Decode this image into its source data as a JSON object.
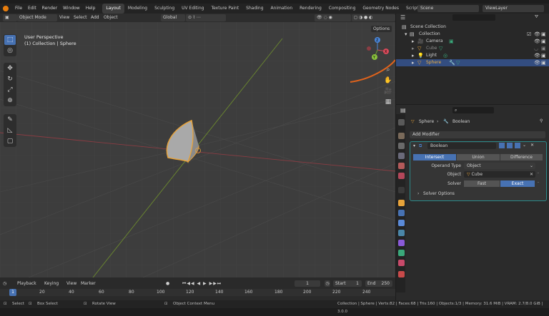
{
  "app": {
    "menus": [
      "File",
      "Edit",
      "Render",
      "Window",
      "Help"
    ],
    "workspaces": [
      "Layout",
      "Modeling",
      "Sculpting",
      "UV Editing",
      "Texture Paint",
      "Shading",
      "Animation",
      "Rendering",
      "Compositing",
      "Geometry Nodes",
      "Scripting"
    ],
    "active_workspace": "Layout",
    "scene": "Scene",
    "view_layer": "ViewLayer"
  },
  "viewport": {
    "mode": "Object Mode",
    "menu": [
      "View",
      "Select",
      "Add",
      "Object"
    ],
    "orientation": "Global",
    "perspective": "User Perspective",
    "context": "(1) Collection | Sphere",
    "options": "Options",
    "gizmo": {
      "x": "X",
      "y": "Y",
      "z": "Z"
    }
  },
  "outliner": {
    "root": "Scene Collection",
    "collection": "Collection",
    "items": [
      {
        "label": "Camera"
      },
      {
        "label": "Cube"
      },
      {
        "label": "Light"
      },
      {
        "label": "Sphere"
      }
    ]
  },
  "properties": {
    "breadcrumb_object": "Sphere",
    "breadcrumb_modifier": "Boolean",
    "add_modifier": "Add Modifier",
    "modifier_name": "Boolean",
    "operations": [
      "Intersect",
      "Union",
      "Difference"
    ],
    "active_operation": "Intersect",
    "operand_type_label": "Operand Type",
    "operand_type": "Object",
    "object_label": "Object",
    "object": "Cube",
    "solver_label": "Solver",
    "solver_options": [
      "Fast",
      "Exact"
    ],
    "active_solver": "Exact",
    "solver_options_panel": "Solver Options"
  },
  "timeline": {
    "menus": [
      "Playback",
      "Keying",
      "View",
      "Marker"
    ],
    "current_frame": "1",
    "start_label": "Start",
    "start": "1",
    "end_label": "End",
    "end": "250",
    "ticks": [
      "1",
      "20",
      "40",
      "60",
      "80",
      "100",
      "120",
      "140",
      "160",
      "180",
      "200",
      "220",
      "240"
    ]
  },
  "status": {
    "select": "Select",
    "box_select": "Box Select",
    "rotate_view": "Rotate View",
    "context_menu": "Object Context Menu",
    "stats": "Collection | Sphere | Verts:82 | Faces:68 | Tris:160 | Objects:1/3 | Memory: 31.6 MiB | VRAM: 2.7/8.0 GiB | 3.0.0"
  },
  "colors": {
    "accent": "#4772b3",
    "selection": "#334d80",
    "arrow": "#e0631c",
    "object_outline": "#e8a33a"
  }
}
